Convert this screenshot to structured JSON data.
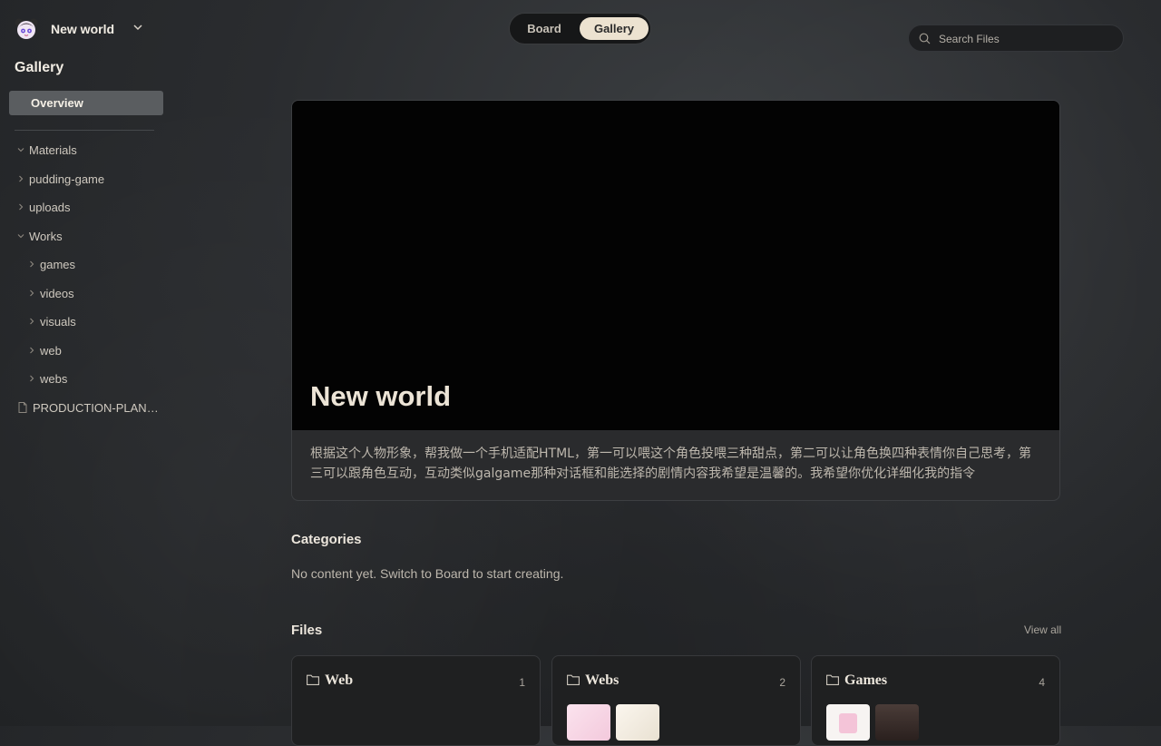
{
  "workspace": {
    "name": "New world",
    "logo_icon": "avatar-logo-icon",
    "chevron_icon": "chevron-down-icon"
  },
  "sidebar": {
    "title": "Gallery",
    "overview_label": "Overview",
    "tree": [
      {
        "label": "Materials",
        "expanded": true,
        "level": 0
      },
      {
        "label": "pudding-game",
        "expanded": false,
        "level": 0
      },
      {
        "label": "uploads",
        "expanded": false,
        "level": 0
      },
      {
        "label": "Works",
        "expanded": true,
        "level": 0
      },
      {
        "label": "games",
        "expanded": false,
        "level": 1
      },
      {
        "label": "videos",
        "expanded": false,
        "level": 1
      },
      {
        "label": "visuals",
        "expanded": false,
        "level": 1
      },
      {
        "label": "web",
        "expanded": false,
        "level": 1
      },
      {
        "label": "webs",
        "expanded": false,
        "level": 1
      },
      {
        "label": "PRODUCTION-PLAN....",
        "type": "file",
        "level": 0
      }
    ]
  },
  "tabs": {
    "board": "Board",
    "gallery": "Gallery",
    "active": "gallery"
  },
  "search": {
    "placeholder": "Search Files"
  },
  "hero": {
    "title": "New world",
    "description": "根据这个人物形象，帮我做一个手机适配HTML，第一可以喂这个角色投喂三种甜点，第二可以让角色换四种表情你自己思考，第三可以跟角色互动，互动类似galgame那种对话框和能选择的剧情内容我希望是温馨的。我希望你优化详细化我的指令"
  },
  "categories": {
    "title": "Categories",
    "empty_text": "No content yet. Switch to Board to start creating."
  },
  "files": {
    "title": "Files",
    "view_all": "View all",
    "cards": [
      {
        "title": "Web",
        "count": "1"
      },
      {
        "title": "Webs",
        "count": "2"
      },
      {
        "title": "Games",
        "count": "4"
      }
    ]
  },
  "colors": {
    "accent": "#ece2d0",
    "background": "#2a2c2f",
    "hero_banner": "#030303"
  }
}
